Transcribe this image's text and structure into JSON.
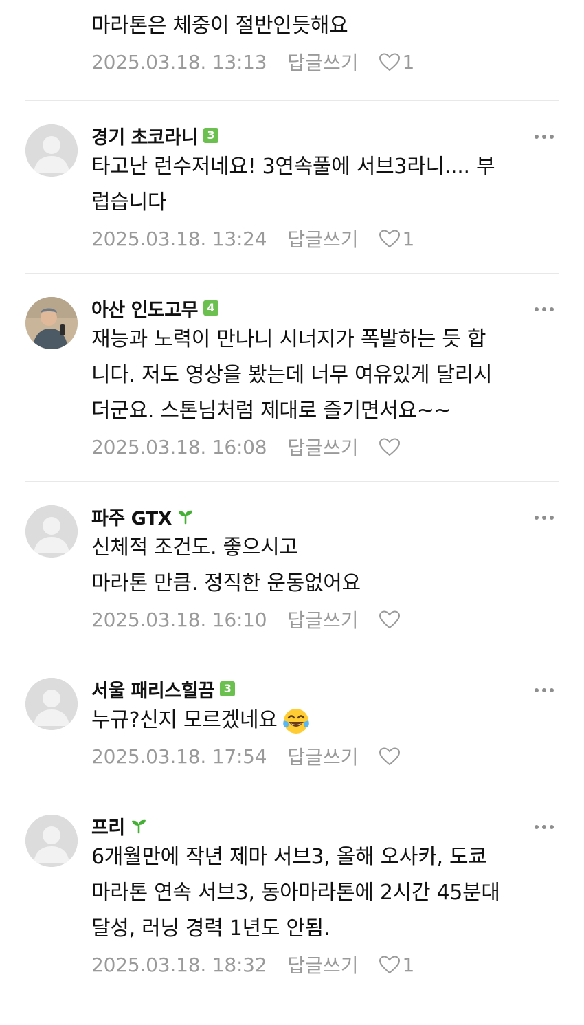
{
  "comments": [
    {
      "author": "",
      "text": [
        "마라톤은 체중이 절반인듯해요"
      ],
      "date": "2025.03.18. 13:13",
      "reply_label": "답글쓰기",
      "likes": "1"
    },
    {
      "author": "경기 초코라니",
      "level": "3",
      "text": [
        "타고난 런수저네요! 3연속풀에 서브3라니.... 부",
        "럽습니다"
      ],
      "date": "2025.03.18. 13:24",
      "reply_label": "답글쓰기",
      "likes": "1"
    },
    {
      "author": "아산 인도고무",
      "level": "4",
      "text": [
        "재능과 노력이 만나니 시너지가 폭발하는 듯 합",
        "니다. 저도 영상을 봤는데 너무 여유있게 달리시",
        "더군요. 스톤님처럼 제대로 즐기면서요~~"
      ],
      "date": "2025.03.18. 16:08",
      "reply_label": "답글쓰기",
      "likes": ""
    },
    {
      "author": "파주 GTX",
      "text": [
        "신체적 조건도. 좋으시고",
        "마라톤 만큼. 정직한 운동없어요"
      ],
      "date": "2025.03.18. 16:10",
      "reply_label": "답글쓰기",
      "likes": ""
    },
    {
      "author": "서울 패리스힐끔",
      "level": "3",
      "text": [
        "누규?신지 모르겠네요"
      ],
      "date": "2025.03.18. 17:54",
      "reply_label": "답글쓰기",
      "likes": ""
    },
    {
      "author": "프리",
      "text": [
        "6개월만에 작년 제마 서브3, 올해 오사카, 도쿄",
        "마라톤 연속 서브3, 동아마라톤에 2시간 45분대",
        "달성, 러닝 경력 1년도 안됨."
      ],
      "date": "2025.03.18. 18:32",
      "reply_label": "답글쓰기",
      "likes": "1"
    }
  ],
  "colors": {
    "level_badge": "#6bc04f",
    "sprout": "#45b035",
    "meta_text": "#9a9a9a",
    "divider": "#e8e8e8"
  }
}
